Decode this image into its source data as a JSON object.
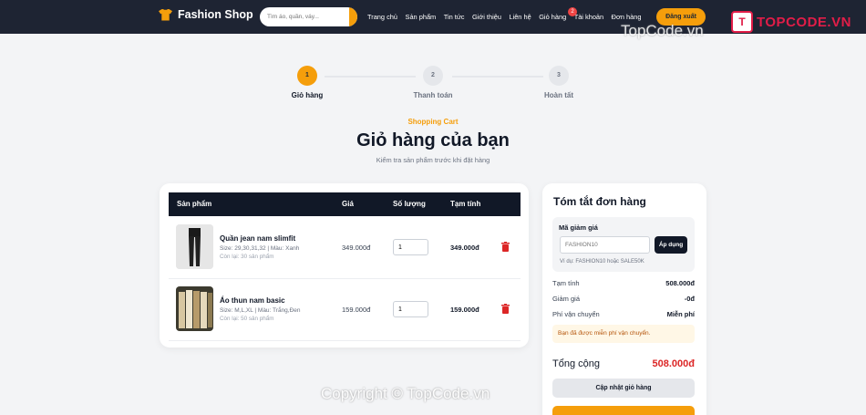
{
  "header": {
    "brand": "Fashion Shop",
    "search_placeholder": "Tìm áo, quần, váy...",
    "nav": [
      "Trang chủ",
      "Sản phẩm",
      "Tin tức",
      "Giới thiệu",
      "Liên hệ",
      "Giỏ hàng",
      "Tài khoản",
      "Đơn hàng"
    ],
    "cart_count": "2",
    "logout_label": "Đăng xuất"
  },
  "watermark": {
    "logo_mark": "T",
    "logo_text": "TOPCODE.VN",
    "top_text": "TopCode.vn",
    "bottom_text": "Copyright © TopCode.vn"
  },
  "steps": [
    {
      "num": "1",
      "label": "Giỏ hàng"
    },
    {
      "num": "2",
      "label": "Thanh toán"
    },
    {
      "num": "3",
      "label": "Hoàn tất"
    }
  ],
  "intro": {
    "kicker": "Shopping Cart",
    "title": "Giỏ hàng của bạn",
    "subtitle": "Kiểm tra sản phẩm trước khi đặt hàng"
  },
  "table": {
    "headers": [
      "Sản phẩm",
      "Giá",
      "Số lượng",
      "Tạm tính"
    ],
    "rows": [
      {
        "name": "Quần jean nam slimfit",
        "meta": "Size: 29,30,31,32 | Màu: Xanh",
        "stock": "Còn lại: 30 sản phẩm",
        "price": "349.000đ",
        "qty": "1",
        "subtotal": "349.000đ"
      },
      {
        "name": "Áo thun nam basic",
        "meta": "Size: M,L,XL | Màu: Trắng,Đen",
        "stock": "Còn lại: 50 sản phẩm",
        "price": "159.000đ",
        "qty": "1",
        "subtotal": "159.000đ"
      }
    ]
  },
  "summary": {
    "title": "Tóm tắt đơn hàng",
    "coupon_label": "Mã giảm giá",
    "coupon_placeholder": "FASHION10",
    "apply_label": "Áp dụng",
    "coupon_hint": "Ví dụ: FASHION10 hoặc SALE50K",
    "subtotal_label": "Tạm tính",
    "subtotal_value": "508.000đ",
    "discount_label": "Giảm giá",
    "discount_value": "-0đ",
    "shipping_label": "Phí vận chuyển",
    "shipping_value": "Miễn phí",
    "ship_note": "Bạn đã được miễn phí vận chuyển.",
    "total_label": "Tổng cộng",
    "total_value": "508.000đ",
    "update_label": "Cập nhật giỏ hàng",
    "accent": "#f59e0b"
  }
}
